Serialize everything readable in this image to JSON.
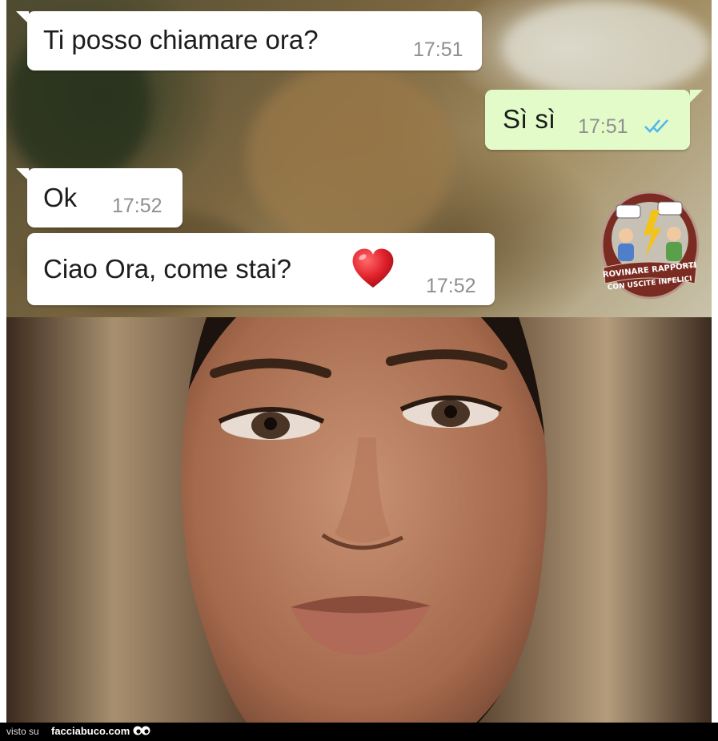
{
  "chat": {
    "messages": [
      {
        "direction": "incoming",
        "text": "Ti posso chiamare ora?",
        "time": "17:51"
      },
      {
        "direction": "outgoing",
        "text": "Sì sì",
        "time": "17:51",
        "status_icon": "double-check-icon"
      },
      {
        "direction": "incoming",
        "text": "Ok",
        "time": "17:52"
      },
      {
        "direction": "incoming",
        "text": "Ciao Ora, come stai?",
        "emoji": "red-heart-icon",
        "time": "17:52"
      }
    ]
  },
  "sticker": {
    "line1": "ROVINARE RAPPORTI",
    "line2": "CON USCITE INFELICI"
  },
  "footer": {
    "seen_on": "visto su",
    "site": "facciabuco.com",
    "icon": "eyes-icon"
  },
  "colors": {
    "incoming_bubble": "#ffffff",
    "outgoing_bubble": "#e2fbc9",
    "timestamp": "#8f8f8f",
    "read_check": "#4fb6ec",
    "heart": "#e0202a",
    "footer_bg": "#000000"
  }
}
